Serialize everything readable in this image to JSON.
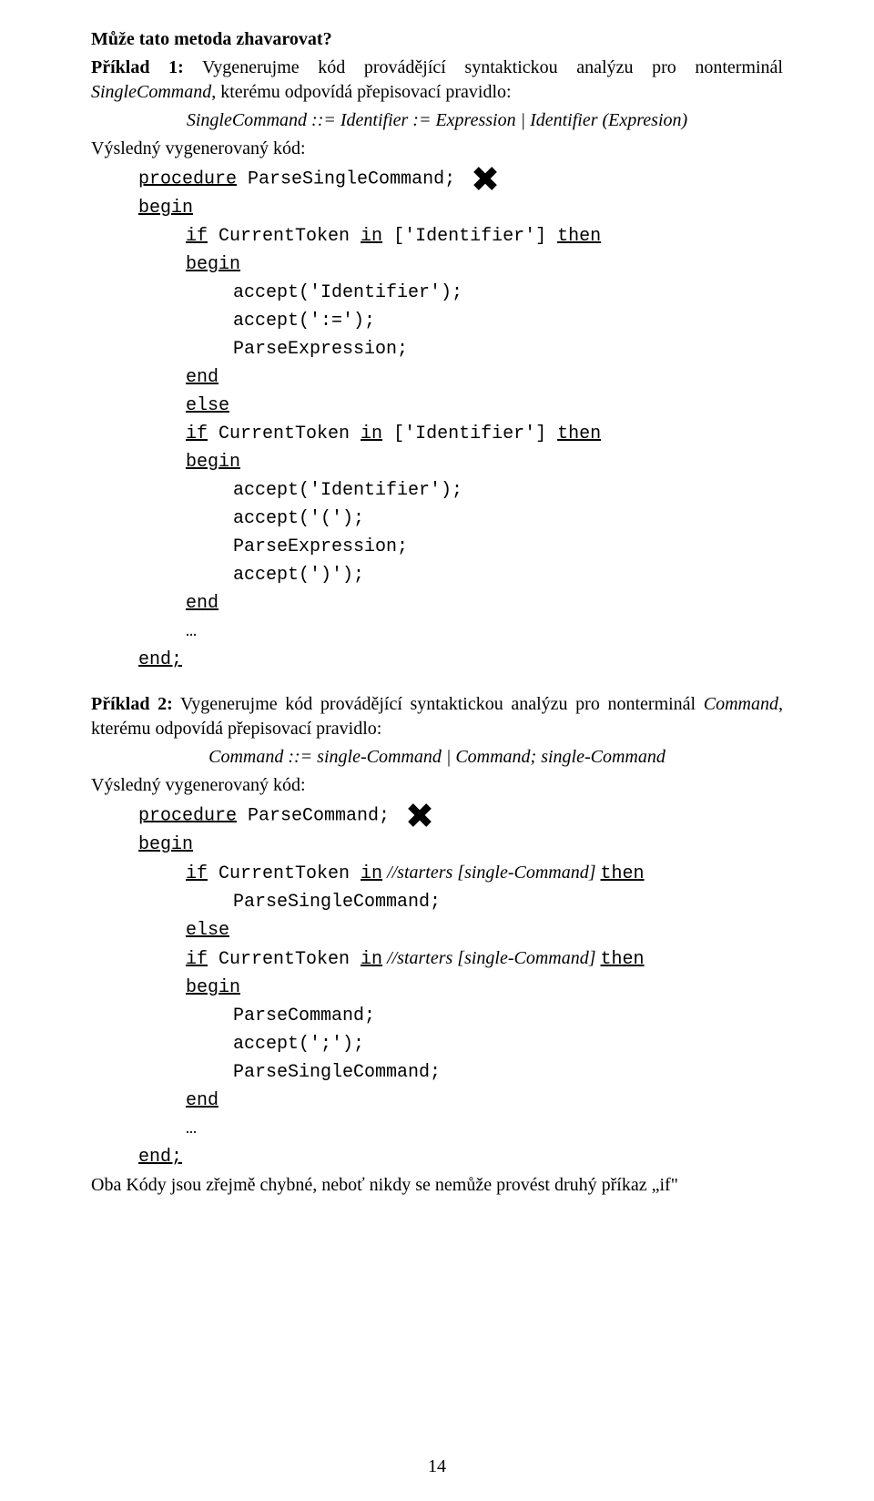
{
  "heading": "Může tato metoda zhavarovat?",
  "ex1": {
    "title_bold": "Příklad 1:",
    "title_rest": " Vygenerujme kód provádějící syntaktickou analýzu pro nonterminál ",
    "title_tail": ", kterému odpovídá přepisovací pravidlo:",
    "nonterminal": "SingleCommand",
    "grammar": "SingleCommand ::= Identifier := Expression | Identifier (Expresion)",
    "resultlabel": "Výsledný vygenerovaný kód:",
    "code": {
      "l1a": "procedure",
      "l1b": " ParseSingleCommand;",
      "l2": "begin",
      "l3a": "if",
      "l3b": " CurrentToken ",
      "l3c": "in",
      "l3d": " ['Identifier'] ",
      "l3e": "then",
      "l4": "begin",
      "l5": "accept('Identifier');",
      "l6": "accept(':=');",
      "l7": "ParseExpression;",
      "l8": "end",
      "l9": "else",
      "l10a": "if",
      "l10b": " CurrentToken ",
      "l10c": "in",
      "l10d": " ['Identifier'] ",
      "l10e": "then",
      "l11": "begin",
      "l12": "accept('Identifier');",
      "l13": "accept('(');",
      "l14": "ParseExpression;",
      "l15": "accept(')');",
      "l16": "end",
      "l17": "…",
      "l18": "end;"
    }
  },
  "ex2": {
    "title_bold": "Příklad 2:",
    "title_rest": " Vygenerujme kód provádějící syntaktickou analýzu pro nonterminál ",
    "title_tail": ", kterému odpovídá přepisovací pravidlo:",
    "nonterminal": "Command",
    "grammar": "Command ::= single-Command | Command; single-Command",
    "resultlabel": "Výsledný vygenerovaný kód:",
    "code": {
      "l1a": "procedure",
      "l1b": " ParseCommand;",
      "l2": "begin",
      "l3a": "if",
      "l3b": " CurrentToken ",
      "l3c": "in",
      "l3d": " //starters [single-Command] ",
      "l3e": "then",
      "l4": "ParseSingleCommand;",
      "l5": "else",
      "l6a": "if",
      "l6b": " CurrentToken ",
      "l6c": "in",
      "l6d": " //starters [single-Command] ",
      "l6e": "then",
      "l7": "begin",
      "l8": "ParseCommand;",
      "l9": "accept(';');",
      "l10": "ParseSingleCommand;",
      "l11": "end",
      "l12": "…",
      "l13": "end;"
    }
  },
  "conclusion": "Oba Kódy jsou zřejmě chybné, neboť nikdy se nemůže provést druhý příkaz „if\"",
  "pagenum": "14",
  "icons": {
    "cross": "cross-icon"
  }
}
